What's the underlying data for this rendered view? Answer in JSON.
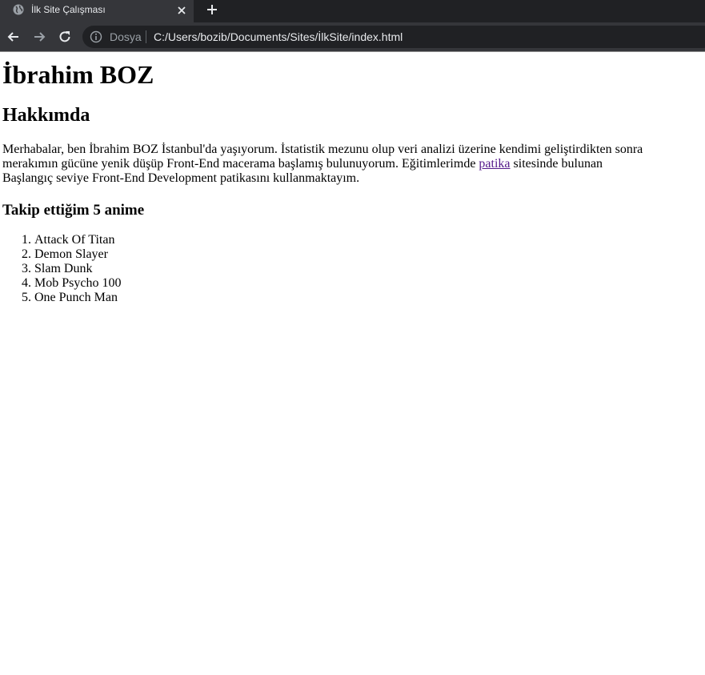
{
  "browser": {
    "tab": {
      "title": "İlk Site Çalışması",
      "favicon": "globe-icon",
      "close_icon": "close-icon"
    },
    "new_tab_icon": "plus-icon",
    "nav": {
      "back_icon": "arrow-left-icon",
      "forward_icon": "arrow-right-icon",
      "reload_icon": "reload-icon"
    },
    "omnibox": {
      "info_icon": "info-icon",
      "scheme_label": "Dosya",
      "url": "C:/Users/bozib/Documents/Sites/İlkSite/index.html"
    },
    "colors": {
      "tabstrip": "#202124",
      "toolbar": "#35363a",
      "omnibox": "#202124",
      "link_visited": "#551a8b"
    }
  },
  "page": {
    "heading": "İbrahim BOZ",
    "about_heading": "Hakkımda",
    "about_text_before": "Merhabalar, ben İbrahim BOZ İstanbul'da yaşıyorum. İstatistik mezunu olup veri analizi üzerine kendimi geliştirdikten sonra merakımın gücüne yenik düşüp Front-End macerama başlamış bulunuyorum. Eğitimlerimde ",
    "about_link": "patika",
    "about_text_after": " sitesinde bulunan Başlangıç seviye Front-End Development patikasını kullanmaktayım.",
    "anime_heading": "Takip ettiğim 5 anime",
    "anime_list": [
      "Attack Of Titan",
      "Demon Slayer",
      "Slam Dunk",
      "Mob Psycho 100",
      "One Punch Man"
    ]
  }
}
